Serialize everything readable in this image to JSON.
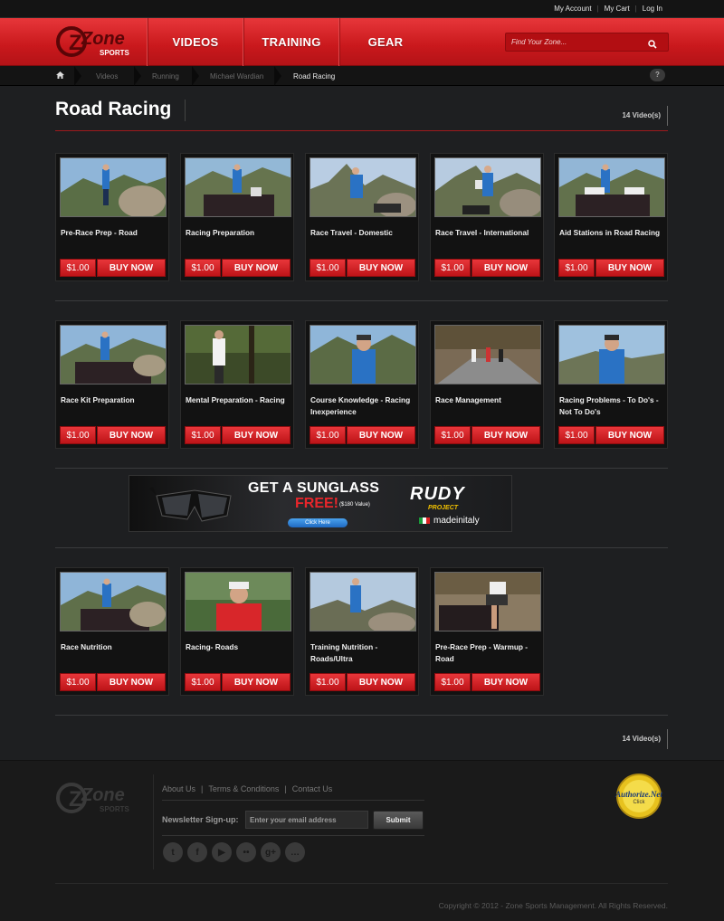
{
  "top_links": [
    "My Account",
    "My Cart",
    "Log In"
  ],
  "brand": {
    "name": "Zone",
    "sub": "SPORTS"
  },
  "nav": [
    "VIDEOS",
    "TRAINING",
    "GEAR"
  ],
  "search": {
    "placeholder": "Find Your Zone..."
  },
  "breadcrumb": [
    "Videos",
    "Running",
    "Michael Wardian",
    "Road Racing"
  ],
  "help_label": "?",
  "page_title": "Road Racing",
  "video_count": "14 Video(s)",
  "videos": [
    {
      "title": "Pre-Race Prep - Road",
      "price": "$1.00",
      "cta": "BUY NOW"
    },
    {
      "title": "Racing Preparation",
      "price": "$1.00",
      "cta": "BUY NOW"
    },
    {
      "title": "Race Travel - Domestic",
      "price": "$1.00",
      "cta": "BUY NOW"
    },
    {
      "title": "Race Travel - International",
      "price": "$1.00",
      "cta": "BUY NOW"
    },
    {
      "title": "Aid Stations in Road Racing",
      "price": "$1.00",
      "cta": "BUY NOW"
    },
    {
      "title": "Race Kit Preparation",
      "price": "$1.00",
      "cta": "BUY NOW"
    },
    {
      "title": "Mental Preparation - Racing",
      "price": "$1.00",
      "cta": "BUY NOW"
    },
    {
      "title": "Course Knowledge - Racing Inexperience",
      "price": "$1.00",
      "cta": "BUY NOW"
    },
    {
      "title": "Race Management",
      "price": "$1.00",
      "cta": "BUY NOW"
    },
    {
      "title": "Racing Problems - To Do's - Not To Do's",
      "price": "$1.00",
      "cta": "BUY NOW"
    },
    {
      "title": "Race Nutrition",
      "price": "$1.00",
      "cta": "BUY NOW"
    },
    {
      "title": "Racing- Roads",
      "price": "$1.00",
      "cta": "BUY NOW"
    },
    {
      "title": "Training Nutrition - Roads/Ultra",
      "price": "$1.00",
      "cta": "BUY NOW"
    },
    {
      "title": "Pre-Race Prep - Warmup - Road",
      "price": "$1.00",
      "cta": "BUY NOW"
    }
  ],
  "banner": {
    "headline": "GET A SUNGLASS",
    "free": "FREE!",
    "value": "($180 Value)",
    "button": "Click Here",
    "brand": "RUDY",
    "brand_sub": "PROJECT",
    "tagline": "madeinitaly"
  },
  "footer": {
    "links": [
      "About Us",
      "Terms & Conditions",
      "Contact Us"
    ],
    "newsletter_label": "Newsletter Sign-up:",
    "newsletter_placeholder": "Enter your email address",
    "submit": "Submit",
    "social_icons": [
      "twitter-icon",
      "facebook-icon",
      "youtube-icon",
      "flickr-icon",
      "google-plus-icon",
      "chat-icon"
    ],
    "copyright": "Copyright © 2012 - Zone Sports Management. All Rights Reserved.",
    "authorize": {
      "line1": "Authorize.Net",
      "line2": "Click"
    }
  },
  "colors": {
    "accent": "#d4191d",
    "bg": "#1e1f21"
  }
}
